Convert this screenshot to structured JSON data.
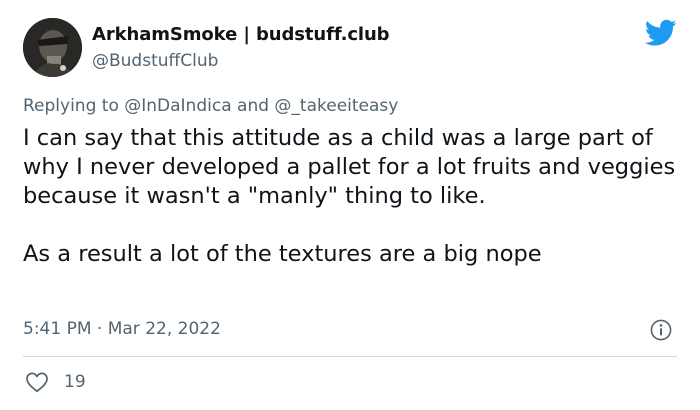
{
  "author": {
    "display_name": "ArkhamSmoke | budstuff.club",
    "handle": "@BudstuffClub"
  },
  "reply": {
    "prefix": "Replying to ",
    "mention1": "@InDaIndica",
    "joiner": " and ",
    "mention2": "@_takeeiteasy"
  },
  "tweet": {
    "paragraph1": "I can say that this attitude as a child was a large part of why I never developed a pallet for a lot fruits and veggies because it wasn't a \"manly\" thing to like.",
    "paragraph2": "As a result a lot of the textures are a big nope"
  },
  "meta": {
    "timestamp": "5:41 PM · Mar 22, 2022"
  },
  "actions": {
    "like_count": "19"
  },
  "icons": {
    "brand": "twitter-bird-icon",
    "info": "info-icon",
    "like": "heart-icon"
  },
  "colors": {
    "twitter_blue": "#1d9bf0",
    "secondary_text": "#536471",
    "primary_text": "#0f1419",
    "divider": "#cfd9de"
  }
}
